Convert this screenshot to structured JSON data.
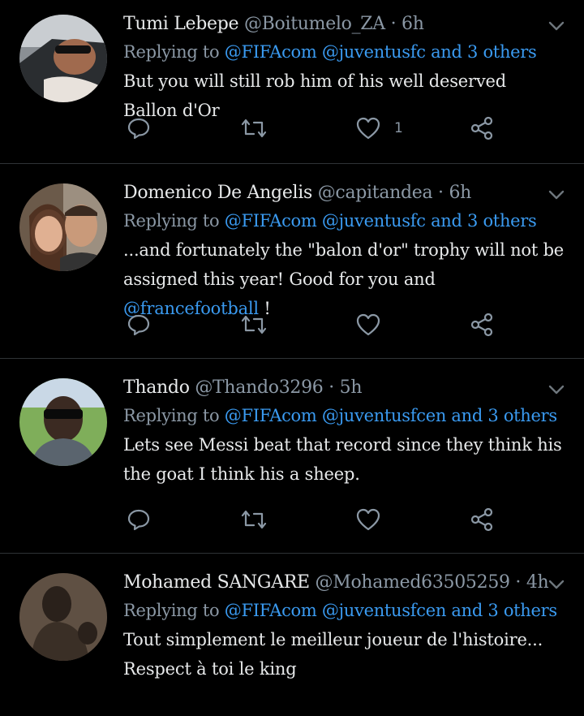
{
  "tweets": [
    {
      "name": "Tumi Lebepe",
      "handle": "@Boitumelo_ZA",
      "time": "6h",
      "reply_prefix": "Replying to",
      "reply_mentions": "@FIFAcom @juventusfc and 3 others",
      "text": "But you will still rob him of his well deserved  Ballon d'Or",
      "text_link": "",
      "text_after": "",
      "like_count": "1"
    },
    {
      "name": "Domenico De Angelis",
      "handle": "@capitandea",
      "time": "6h",
      "reply_prefix": "Replying to",
      "reply_mentions": "@FIFAcom @juventusfc and 3 others",
      "text": "...and fortunately the \"balon d'or\" trophy will not be assigned this year! Good for you and ",
      "text_link": "@francefootball",
      "text_after": " !",
      "like_count": ""
    },
    {
      "name": "Thando",
      "handle": "@Thando3296",
      "time": "5h",
      "reply_prefix": "Replying to",
      "reply_mentions": "@FIFAcom @juventusfcen and 3 others",
      "text": "Lets see Messi beat that record since they think his the goat I think his a sheep.",
      "text_link": "",
      "text_after": "",
      "like_count": ""
    },
    {
      "name": "Mohamed SANGARE",
      "handle": "@Mohamed63505259",
      "time": "4h",
      "reply_prefix": "Replying to",
      "reply_mentions": "@FIFAcom @juventusfcen and 3 others",
      "text": "Tout simplement le meilleur joueur de l'histoire... Respect à toi le king",
      "text_link": "",
      "text_after": "",
      "like_count": ""
    }
  ],
  "icons": {
    "reply": "reply-icon",
    "retweet": "retweet-icon",
    "like": "heart-icon",
    "share": "share-icon",
    "menu": "chevron-down-icon"
  },
  "colors": {
    "background": "#000000",
    "link": "#3a9af0",
    "muted": "#8b98a5",
    "divider": "#2f3336"
  }
}
